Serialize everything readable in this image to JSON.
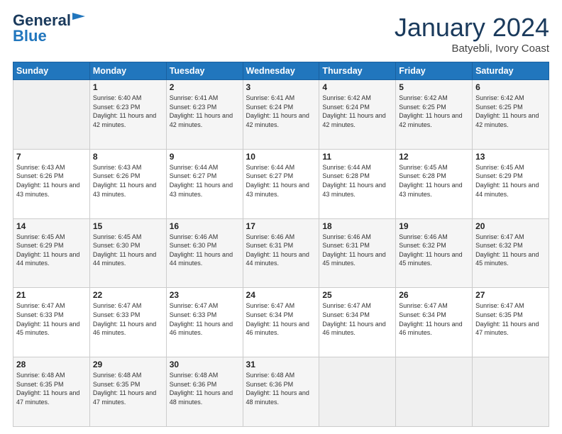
{
  "logo": {
    "text1": "General",
    "text2": "Blue"
  },
  "title": "January 2024",
  "subtitle": "Batyebli, Ivory Coast",
  "days_header": [
    "Sunday",
    "Monday",
    "Tuesday",
    "Wednesday",
    "Thursday",
    "Friday",
    "Saturday"
  ],
  "weeks": [
    [
      {
        "num": "",
        "empty": true
      },
      {
        "num": "1",
        "sunrise": "6:40 AM",
        "sunset": "6:23 PM",
        "daylight": "11 hours and 42 minutes."
      },
      {
        "num": "2",
        "sunrise": "6:41 AM",
        "sunset": "6:23 PM",
        "daylight": "11 hours and 42 minutes."
      },
      {
        "num": "3",
        "sunrise": "6:41 AM",
        "sunset": "6:24 PM",
        "daylight": "11 hours and 42 minutes."
      },
      {
        "num": "4",
        "sunrise": "6:42 AM",
        "sunset": "6:24 PM",
        "daylight": "11 hours and 42 minutes."
      },
      {
        "num": "5",
        "sunrise": "6:42 AM",
        "sunset": "6:25 PM",
        "daylight": "11 hours and 42 minutes."
      },
      {
        "num": "6",
        "sunrise": "6:42 AM",
        "sunset": "6:25 PM",
        "daylight": "11 hours and 42 minutes."
      }
    ],
    [
      {
        "num": "7",
        "sunrise": "6:43 AM",
        "sunset": "6:26 PM",
        "daylight": "11 hours and 43 minutes."
      },
      {
        "num": "8",
        "sunrise": "6:43 AM",
        "sunset": "6:26 PM",
        "daylight": "11 hours and 43 minutes."
      },
      {
        "num": "9",
        "sunrise": "6:44 AM",
        "sunset": "6:27 PM",
        "daylight": "11 hours and 43 minutes."
      },
      {
        "num": "10",
        "sunrise": "6:44 AM",
        "sunset": "6:27 PM",
        "daylight": "11 hours and 43 minutes."
      },
      {
        "num": "11",
        "sunrise": "6:44 AM",
        "sunset": "6:28 PM",
        "daylight": "11 hours and 43 minutes."
      },
      {
        "num": "12",
        "sunrise": "6:45 AM",
        "sunset": "6:28 PM",
        "daylight": "11 hours and 43 minutes."
      },
      {
        "num": "13",
        "sunrise": "6:45 AM",
        "sunset": "6:29 PM",
        "daylight": "11 hours and 44 minutes."
      }
    ],
    [
      {
        "num": "14",
        "sunrise": "6:45 AM",
        "sunset": "6:29 PM",
        "daylight": "11 hours and 44 minutes."
      },
      {
        "num": "15",
        "sunrise": "6:45 AM",
        "sunset": "6:30 PM",
        "daylight": "11 hours and 44 minutes."
      },
      {
        "num": "16",
        "sunrise": "6:46 AM",
        "sunset": "6:30 PM",
        "daylight": "11 hours and 44 minutes."
      },
      {
        "num": "17",
        "sunrise": "6:46 AM",
        "sunset": "6:31 PM",
        "daylight": "11 hours and 44 minutes."
      },
      {
        "num": "18",
        "sunrise": "6:46 AM",
        "sunset": "6:31 PM",
        "daylight": "11 hours and 45 minutes."
      },
      {
        "num": "19",
        "sunrise": "6:46 AM",
        "sunset": "6:32 PM",
        "daylight": "11 hours and 45 minutes."
      },
      {
        "num": "20",
        "sunrise": "6:47 AM",
        "sunset": "6:32 PM",
        "daylight": "11 hours and 45 minutes."
      }
    ],
    [
      {
        "num": "21",
        "sunrise": "6:47 AM",
        "sunset": "6:33 PM",
        "daylight": "11 hours and 45 minutes."
      },
      {
        "num": "22",
        "sunrise": "6:47 AM",
        "sunset": "6:33 PM",
        "daylight": "11 hours and 46 minutes."
      },
      {
        "num": "23",
        "sunrise": "6:47 AM",
        "sunset": "6:33 PM",
        "daylight": "11 hours and 46 minutes."
      },
      {
        "num": "24",
        "sunrise": "6:47 AM",
        "sunset": "6:34 PM",
        "daylight": "11 hours and 46 minutes."
      },
      {
        "num": "25",
        "sunrise": "6:47 AM",
        "sunset": "6:34 PM",
        "daylight": "11 hours and 46 minutes."
      },
      {
        "num": "26",
        "sunrise": "6:47 AM",
        "sunset": "6:34 PM",
        "daylight": "11 hours and 46 minutes."
      },
      {
        "num": "27",
        "sunrise": "6:47 AM",
        "sunset": "6:35 PM",
        "daylight": "11 hours and 47 minutes."
      }
    ],
    [
      {
        "num": "28",
        "sunrise": "6:48 AM",
        "sunset": "6:35 PM",
        "daylight": "11 hours and 47 minutes."
      },
      {
        "num": "29",
        "sunrise": "6:48 AM",
        "sunset": "6:35 PM",
        "daylight": "11 hours and 47 minutes."
      },
      {
        "num": "30",
        "sunrise": "6:48 AM",
        "sunset": "6:36 PM",
        "daylight": "11 hours and 48 minutes."
      },
      {
        "num": "31",
        "sunrise": "6:48 AM",
        "sunset": "6:36 PM",
        "daylight": "11 hours and 48 minutes."
      },
      {
        "num": "",
        "empty": true
      },
      {
        "num": "",
        "empty": true
      },
      {
        "num": "",
        "empty": true
      }
    ]
  ]
}
